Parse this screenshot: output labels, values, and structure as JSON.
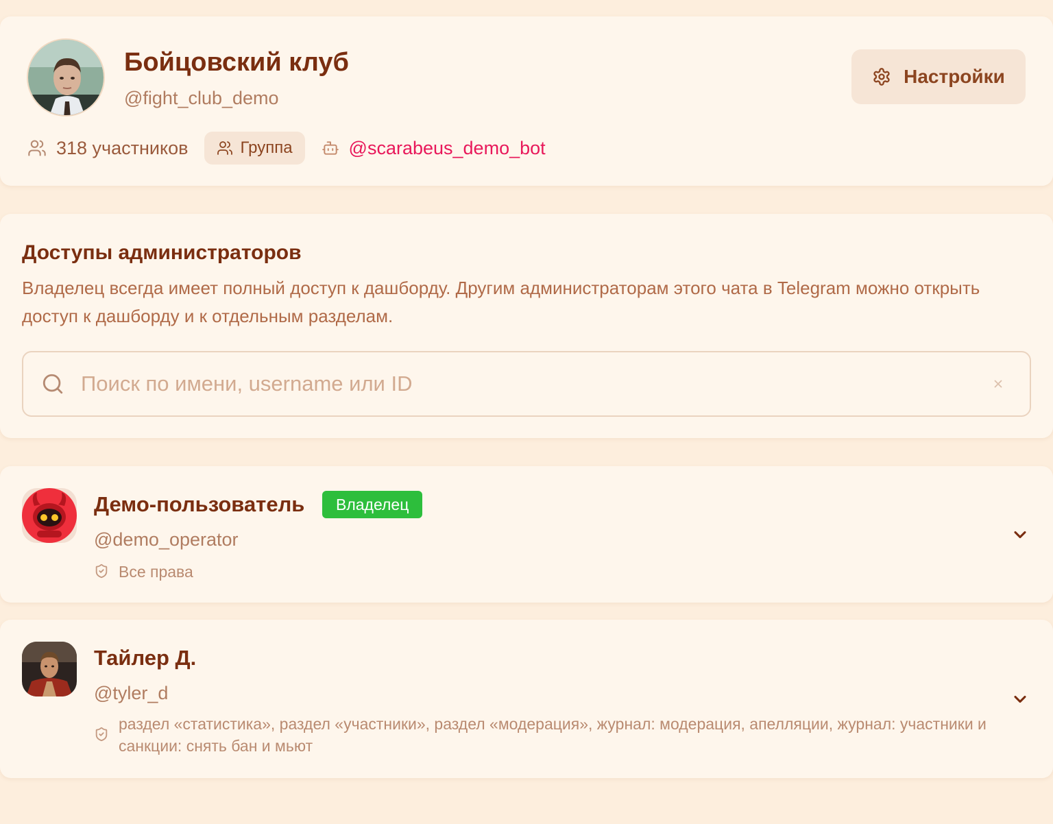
{
  "group": {
    "title": "Бойцовский клуб",
    "handle": "@fight_club_demo",
    "members_text": "318 участников",
    "type_label": "Группа",
    "bot_handle": "@scarabeus_demo_bot",
    "avatar_icon": "profile-photo"
  },
  "header": {
    "settings_label": "Настройки",
    "settings_icon": "gear-icon"
  },
  "admins_section": {
    "title": "Доступы администраторов",
    "description": "Владелец всегда имеет полный доступ к дашборду. Другим администраторам этого чата в Telegram можно открыть доступ к дашборду и к отдельным разделам.",
    "search_placeholder": "Поиск по имени, username или ID",
    "search_value": ""
  },
  "admins": [
    {
      "name": "Демо-пользователь",
      "badge": "Владелец",
      "handle": "@demo_operator",
      "permissions": "Все права"
    },
    {
      "name": "Тайлер Д.",
      "handle": "@tyler_d",
      "permissions": "раздел «статистика», раздел «участники», раздел «модерация», журнал: модерация, апелляции, журнал: участники и санкции: снять бан и мьют"
    }
  ],
  "colors": {
    "page_bg": "#fdeedd",
    "card_bg": "#fef6ec",
    "primary_text": "#7a2e10",
    "accent_pink": "#e8185a",
    "owner_badge": "#2dbe3c"
  }
}
